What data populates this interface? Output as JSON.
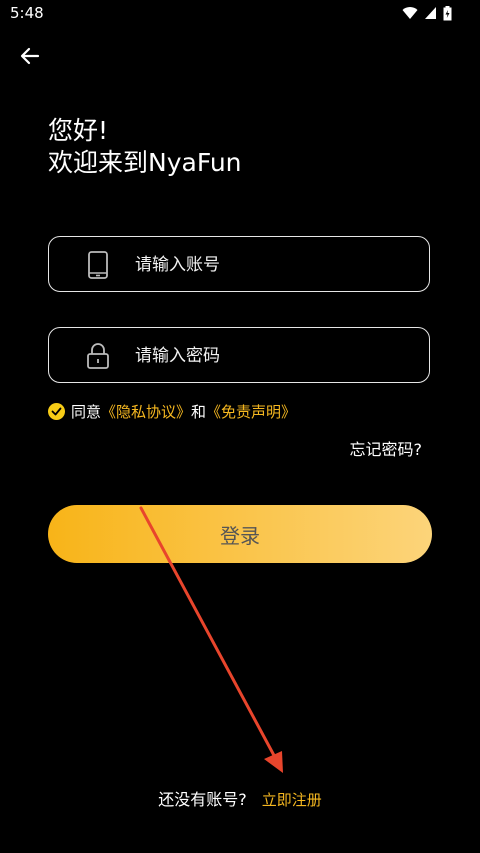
{
  "status": {
    "time": "5:48"
  },
  "greeting": {
    "line1": "您好!",
    "line2": "欢迎来到NyaFun"
  },
  "account": {
    "placeholder": "请输入账号"
  },
  "password": {
    "placeholder": "请输入密码"
  },
  "agreement": {
    "prefix": "同意",
    "privacy": "《隐私协议》",
    "and": "和",
    "disclaimer": "《免责声明》",
    "checked": true
  },
  "forgot": "忘记密码?",
  "login": "登录",
  "register": {
    "question": "还没有账号?",
    "link": "立即注册"
  },
  "colors": {
    "accent": "#f6b820",
    "button_start": "#f8b418",
    "button_end": "#fcd47a",
    "annotation_arrow": "#e8452c"
  },
  "icons": [
    "back-arrow-icon",
    "wifi-icon",
    "signal-icon",
    "battery-icon",
    "phone-icon",
    "lock-icon",
    "check-icon"
  ]
}
